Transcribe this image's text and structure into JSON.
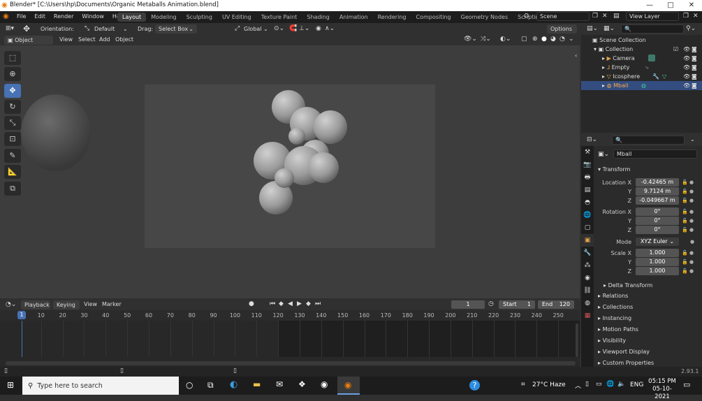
{
  "window": {
    "title": "Blender* [C:\\Users\\hp\\Documents\\Organic Metaballs Animation.blend]",
    "min": "—",
    "max": "□",
    "close": "✕"
  },
  "menu": [
    "File",
    "Edit",
    "Render",
    "Window",
    "Help"
  ],
  "workspaces": [
    "Layout",
    "Modeling",
    "Sculpting",
    "UV Editing",
    "Texture Paint",
    "Shading",
    "Animation",
    "Rendering",
    "Compositing",
    "Geometry Nodes",
    "Scripting"
  ],
  "workspace_add": "+",
  "scene": {
    "name": "Scene",
    "view_layer": "View Layer"
  },
  "tool_header": {
    "orientation_label": "Orientation:",
    "orientation_value": "Default",
    "drag_label": "Drag:",
    "drag_value": "Select Box",
    "transform_space": "Global",
    "options": "Options"
  },
  "viewport_header": {
    "mode": "Object Mode",
    "items": [
      "View",
      "Select",
      "Add",
      "Object"
    ]
  },
  "timeline": {
    "menus": [
      "Playback",
      "Keying",
      "View",
      "Marker"
    ],
    "current_frame": "1",
    "start_label": "Start",
    "start": "1",
    "end_label": "End",
    "end": "120",
    "ticks": [
      "1",
      "10",
      "20",
      "30",
      "40",
      "50",
      "60",
      "70",
      "80",
      "90",
      "100",
      "110",
      "120",
      "130",
      "140",
      "150",
      "160",
      "170",
      "180",
      "190",
      "200",
      "210",
      "220",
      "230",
      "240",
      "250"
    ],
    "playhead": "1"
  },
  "outliner": {
    "scene_collection": "Scene Collection",
    "collection": "Collection",
    "items": [
      {
        "name": "Camera",
        "color": "#e8a54a"
      },
      {
        "name": "Empty",
        "color": "#e8a54a"
      },
      {
        "name": "Icosphere",
        "color": "#e8a54a"
      },
      {
        "name": "Mball",
        "color": "#e8a54a"
      }
    ],
    "selected": "Mball"
  },
  "properties": {
    "object_name": "Mball",
    "transform_label": "Transform",
    "location_label": "Location X",
    "loc_x": "-0.42465 m",
    "loc_y": "9.7124 m",
    "loc_z": "-0.049667 m",
    "rotation_label": "Rotation X",
    "rot_x": "0°",
    "rot_y": "0°",
    "rot_z": "0°",
    "mode_label": "Mode",
    "mode_value": "XYZ Euler",
    "scale_label": "Scale X",
    "scale_x": "1.000",
    "scale_y": "1.000",
    "scale_z": "1.000",
    "y": "Y",
    "z": "Z",
    "delta": "Delta Transform",
    "sections": [
      "Relations",
      "Collections",
      "Instancing",
      "Motion Paths",
      "Visibility",
      "Viewport Display",
      "Custom Properties"
    ]
  },
  "status": {
    "version": "2.93.1"
  },
  "taskbar": {
    "search_placeholder": "Type here to search",
    "weather": "27°C Haze",
    "lang": "ENG",
    "time": "05:15 PM",
    "date": "05-10-2021"
  },
  "colors": {
    "accent": "#4772b3",
    "selected_row": "#334d80",
    "playhead": "#4772b3",
    "taskbar": "#1c1c1c"
  }
}
